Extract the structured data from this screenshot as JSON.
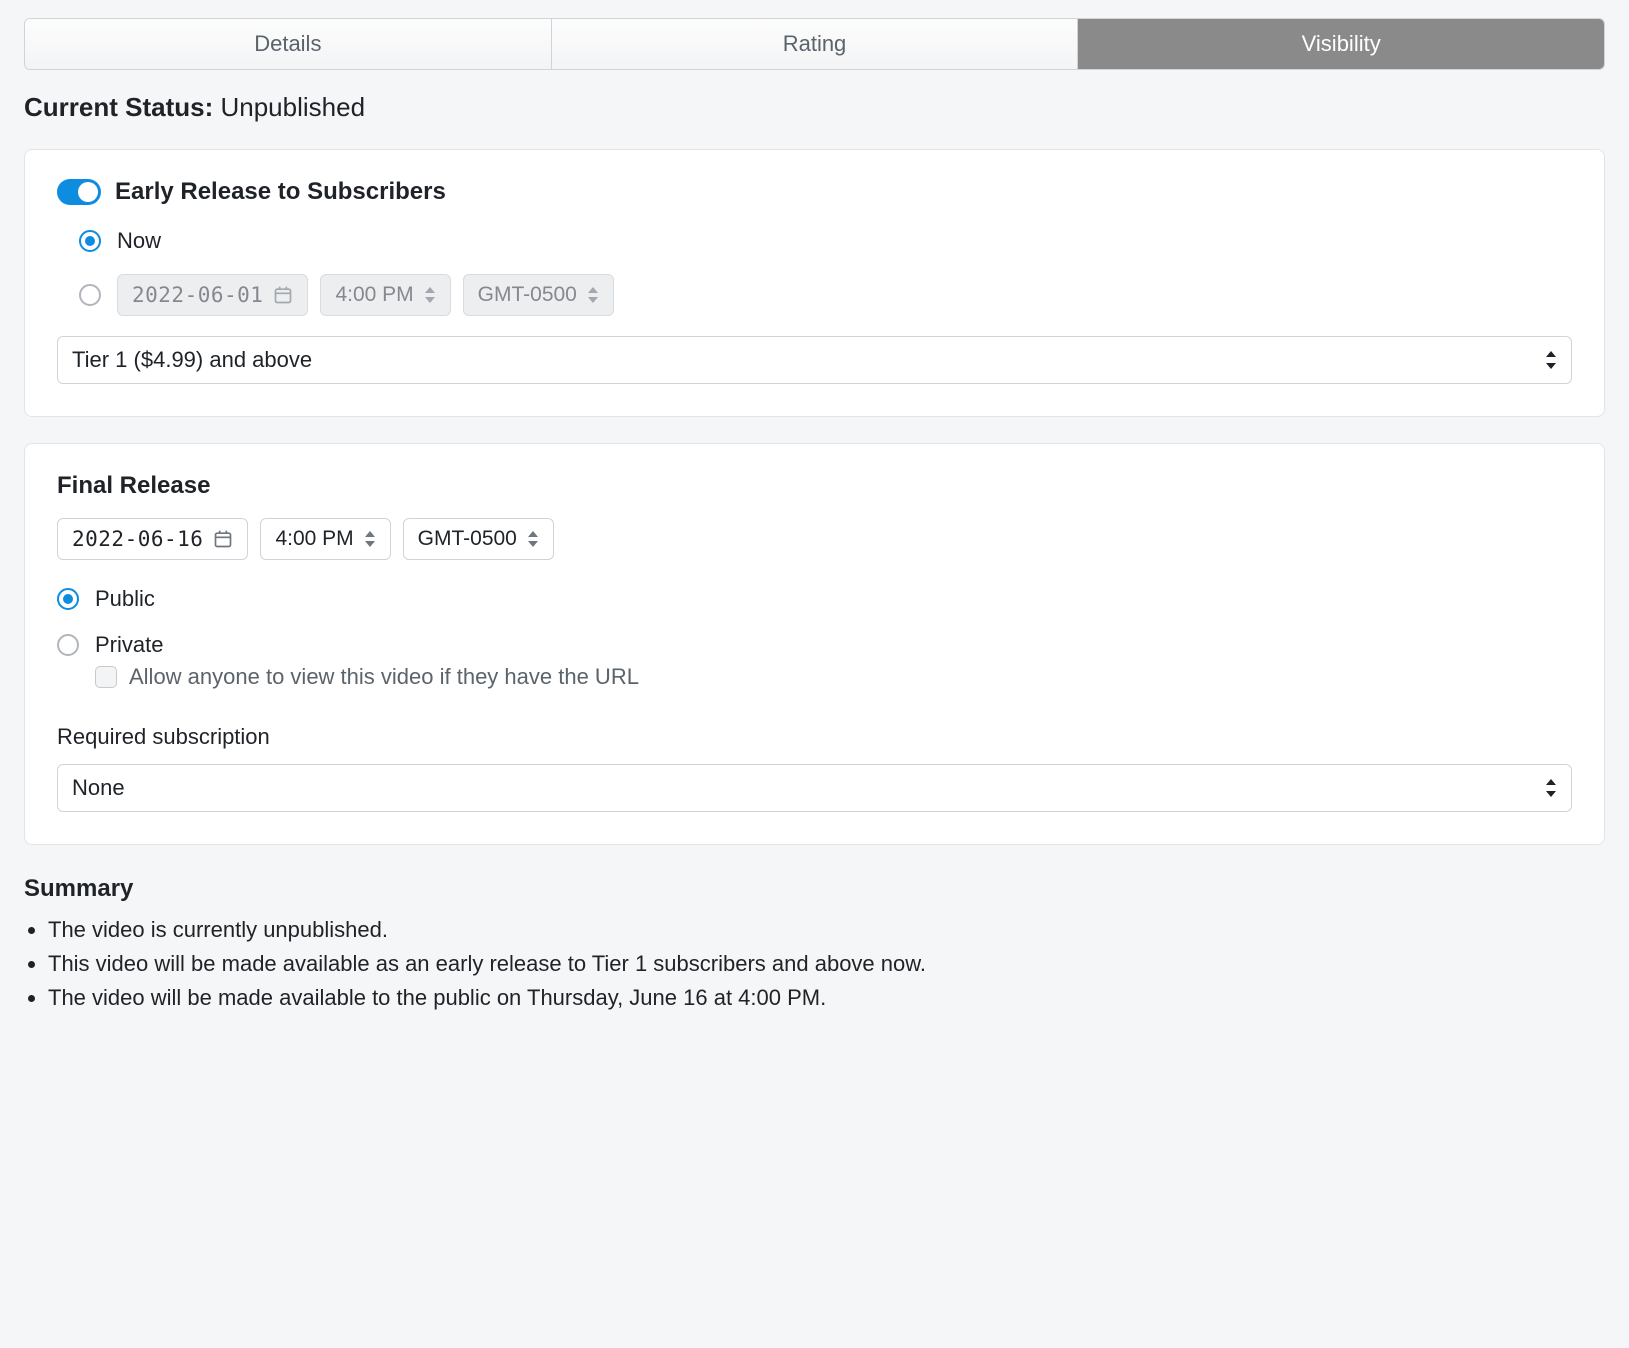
{
  "tabs": {
    "details": "Details",
    "rating": "Rating",
    "visibility": "Visibility"
  },
  "status": {
    "label": "Current Status:",
    "value": "Unpublished"
  },
  "early": {
    "title": "Early Release to Subscribers",
    "now_label": "Now",
    "date": "2022-06-01",
    "time": "4:00 PM",
    "tz": "GMT-0500",
    "tier_selected": "Tier 1 ($4.99) and above"
  },
  "final": {
    "title": "Final Release",
    "date": "2022-06-16",
    "time": "4:00 PM",
    "tz": "GMT-0500",
    "public_label": "Public",
    "private_label": "Private",
    "allow_url_label": "Allow anyone to view this video if they have the URL",
    "required_sub_label": "Required subscription",
    "required_sub_value": "None"
  },
  "summary": {
    "title": "Summary",
    "items": [
      "The video is currently unpublished.",
      "This video will be made available as an early release to Tier 1 subscribers and above now.",
      "The video will be made available to the public on Thursday, June 16 at 4:00 PM."
    ]
  }
}
